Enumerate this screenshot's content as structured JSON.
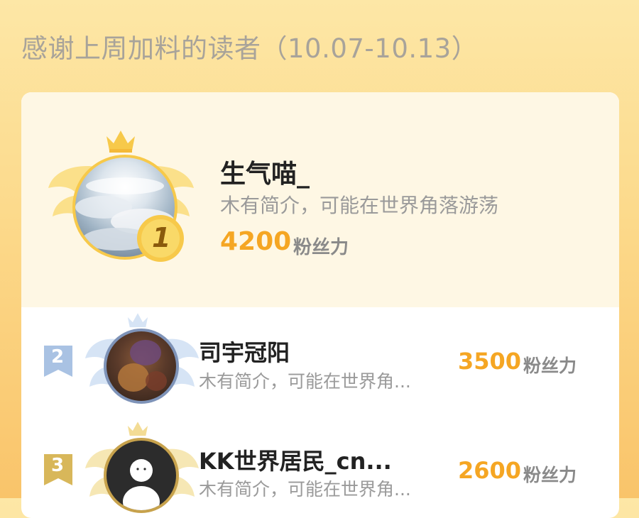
{
  "header": {
    "title": "感谢上周加料的读者（10.07-10.13）"
  },
  "ranking": [
    {
      "rank": "1",
      "name": "生气喵_",
      "bio": "木有简介，可能在世界角落游荡",
      "fans_value": "4200",
      "fans_label": "粉丝力"
    },
    {
      "rank": "2",
      "name": "司宇冠阳",
      "bio": "木有简介，可能在世界角...",
      "fans_value": "3500",
      "fans_label": "粉丝力"
    },
    {
      "rank": "3",
      "name": "KK世界居民_cn...",
      "bio": "木有简介，可能在世界角...",
      "fans_value": "2600",
      "fans_label": "粉丝力"
    }
  ],
  "colors": {
    "gold": "#f5a623",
    "silver": "#a9c2e3",
    "bronze": "#d8b75a"
  },
  "icons": [
    "crown-icon",
    "wings-icon",
    "rank-medal-icon",
    "rank-ribbon-icon",
    "default-avatar-icon"
  ]
}
